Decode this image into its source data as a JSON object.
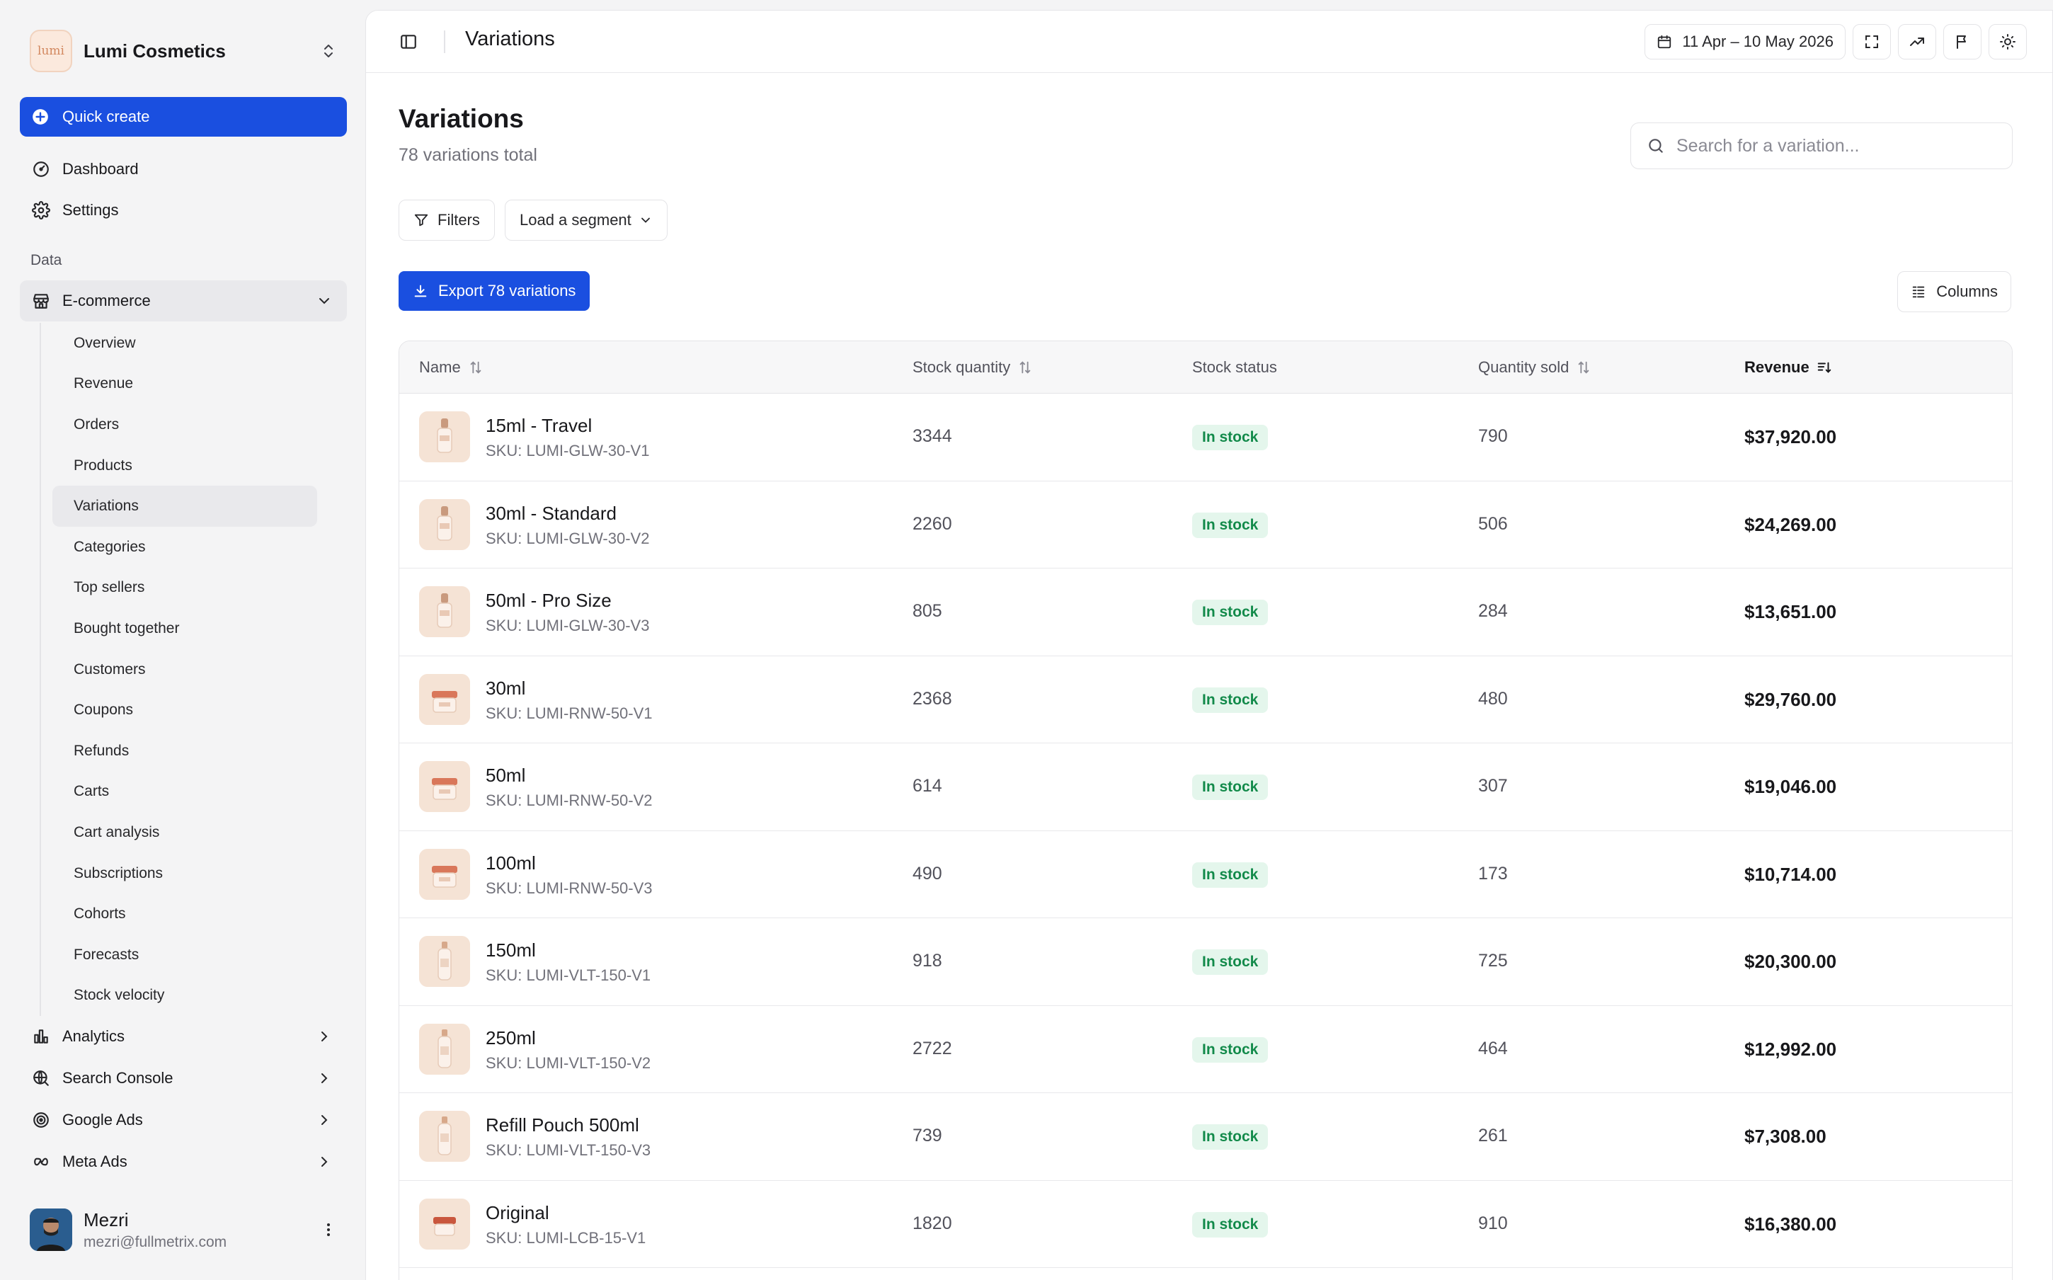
{
  "brand": {
    "name": "Lumi Cosmetics",
    "logo_text": "lumi"
  },
  "sidebar": {
    "quick_create": "Quick create",
    "top_items": [
      {
        "label": "Dashboard",
        "icon": "gauge-icon"
      },
      {
        "label": "Settings",
        "icon": "gear-icon"
      }
    ],
    "section_label": "Data",
    "ecommerce": {
      "label": "E-commerce",
      "icon": "store-icon",
      "sub_items": [
        "Overview",
        "Revenue",
        "Orders",
        "Products",
        "Variations",
        "Categories",
        "Top sellers",
        "Bought together",
        "Customers",
        "Coupons",
        "Refunds",
        "Carts",
        "Cart analysis",
        "Subscriptions",
        "Cohorts",
        "Forecasts",
        "Stock velocity"
      ],
      "active": "Variations"
    },
    "bottom_items": [
      {
        "label": "Analytics",
        "icon": "bar-chart-icon"
      },
      {
        "label": "Search Console",
        "icon": "globe-search-icon"
      },
      {
        "label": "Google Ads",
        "icon": "target-icon"
      },
      {
        "label": "Meta Ads",
        "icon": "infinity-icon"
      }
    ],
    "user": {
      "name": "Mezri",
      "email": "mezri@fullmetrix.com"
    }
  },
  "topbar": {
    "title": "Variations",
    "date_range": "11 Apr – 10 May 2026"
  },
  "page": {
    "title": "Variations",
    "subtitle": "78 variations total",
    "search_placeholder": "Search for a variation...",
    "filters_label": "Filters",
    "segment_label": "Load a segment",
    "export_label": "Export 78 variations",
    "columns_label": "Columns"
  },
  "table": {
    "columns": {
      "name": "Name",
      "stock_qty": "Stock quantity",
      "stock_status": "Stock status",
      "qty_sold": "Quantity sold",
      "revenue": "Revenue"
    },
    "rows": [
      {
        "name": "15ml - Travel",
        "sku": "SKU: LUMI-GLW-30-V1",
        "stock_qty": "3344",
        "status": "In stock",
        "sold": "790",
        "revenue": "$37,920.00",
        "thumb": "dropper"
      },
      {
        "name": "30ml - Standard",
        "sku": "SKU: LUMI-GLW-30-V2",
        "stock_qty": "2260",
        "status": "In stock",
        "sold": "506",
        "revenue": "$24,269.00",
        "thumb": "dropper"
      },
      {
        "name": "50ml - Pro Size",
        "sku": "SKU: LUMI-GLW-30-V3",
        "stock_qty": "805",
        "status": "In stock",
        "sold": "284",
        "revenue": "$13,651.00",
        "thumb": "dropper"
      },
      {
        "name": "30ml",
        "sku": "SKU: LUMI-RNW-50-V1",
        "stock_qty": "2368",
        "status": "In stock",
        "sold": "480",
        "revenue": "$29,760.00",
        "thumb": "jar"
      },
      {
        "name": "50ml",
        "sku": "SKU: LUMI-RNW-50-V2",
        "stock_qty": "614",
        "status": "In stock",
        "sold": "307",
        "revenue": "$19,046.00",
        "thumb": "jar"
      },
      {
        "name": "100ml",
        "sku": "SKU: LUMI-RNW-50-V3",
        "stock_qty": "490",
        "status": "In stock",
        "sold": "173",
        "revenue": "$10,714.00",
        "thumb": "jar"
      },
      {
        "name": "150ml",
        "sku": "SKU: LUMI-VLT-150-V1",
        "stock_qty": "918",
        "status": "In stock",
        "sold": "725",
        "revenue": "$20,300.00",
        "thumb": "bottle"
      },
      {
        "name": "250ml",
        "sku": "SKU: LUMI-VLT-150-V2",
        "stock_qty": "2722",
        "status": "In stock",
        "sold": "464",
        "revenue": "$12,992.00",
        "thumb": "bottle"
      },
      {
        "name": "Refill Pouch 500ml",
        "sku": "SKU: LUMI-VLT-150-V3",
        "stock_qty": "739",
        "status": "In stock",
        "sold": "261",
        "revenue": "$7,308.00",
        "thumb": "bottle"
      },
      {
        "name": "Original",
        "sku": "SKU: LUMI-LCB-15-V1",
        "stock_qty": "1820",
        "status": "In stock",
        "sold": "910",
        "revenue": "$16,380.00",
        "thumb": "balm"
      }
    ]
  },
  "colors": {
    "accent": "#1a4fe0",
    "success_bg": "#e4f6ec",
    "success_text": "#128a4a"
  }
}
